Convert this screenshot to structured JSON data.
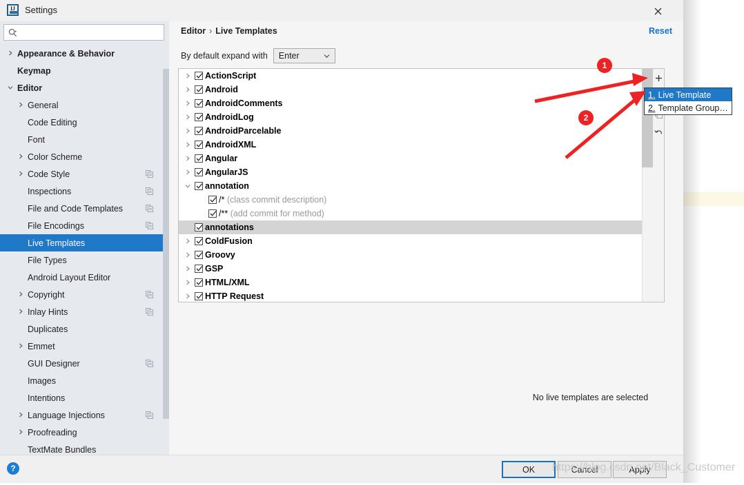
{
  "window": {
    "title": "Settings",
    "app_icon": "intellij-idea-icon",
    "close_icon": "close-icon"
  },
  "search": {
    "placeholder": "",
    "value": "",
    "icon": "search-icon"
  },
  "sidebar": {
    "items": [
      {
        "label": "Appearance & Behavior",
        "level": 0,
        "arrow": "chevron-right-icon",
        "copy": false,
        "selected": false
      },
      {
        "label": "Keymap",
        "level": 0,
        "arrow": "",
        "copy": false,
        "selected": false
      },
      {
        "label": "Editor",
        "level": 0,
        "arrow": "chevron-down-icon",
        "copy": false,
        "selected": false
      },
      {
        "label": "General",
        "level": 1,
        "arrow": "chevron-right-icon",
        "copy": false,
        "selected": false
      },
      {
        "label": "Code Editing",
        "level": 1,
        "arrow": "",
        "copy": false,
        "selected": false
      },
      {
        "label": "Font",
        "level": 1,
        "arrow": "",
        "copy": false,
        "selected": false
      },
      {
        "label": "Color Scheme",
        "level": 1,
        "arrow": "chevron-right-icon",
        "copy": false,
        "selected": false
      },
      {
        "label": "Code Style",
        "level": 1,
        "arrow": "chevron-right-icon",
        "copy": true,
        "selected": false
      },
      {
        "label": "Inspections",
        "level": 1,
        "arrow": "",
        "copy": true,
        "selected": false
      },
      {
        "label": "File and Code Templates",
        "level": 1,
        "arrow": "",
        "copy": true,
        "selected": false
      },
      {
        "label": "File Encodings",
        "level": 1,
        "arrow": "",
        "copy": true,
        "selected": false
      },
      {
        "label": "Live Templates",
        "level": 1,
        "arrow": "",
        "copy": false,
        "selected": true
      },
      {
        "label": "File Types",
        "level": 1,
        "arrow": "",
        "copy": false,
        "selected": false
      },
      {
        "label": "Android Layout Editor",
        "level": 1,
        "arrow": "",
        "copy": false,
        "selected": false
      },
      {
        "label": "Copyright",
        "level": 1,
        "arrow": "chevron-right-icon",
        "copy": true,
        "selected": false
      },
      {
        "label": "Inlay Hints",
        "level": 1,
        "arrow": "chevron-right-icon",
        "copy": true,
        "selected": false
      },
      {
        "label": "Duplicates",
        "level": 1,
        "arrow": "",
        "copy": false,
        "selected": false
      },
      {
        "label": "Emmet",
        "level": 1,
        "arrow": "chevron-right-icon",
        "copy": false,
        "selected": false
      },
      {
        "label": "GUI Designer",
        "level": 1,
        "arrow": "",
        "copy": true,
        "selected": false
      },
      {
        "label": "Images",
        "level": 1,
        "arrow": "",
        "copy": false,
        "selected": false
      },
      {
        "label": "Intentions",
        "level": 1,
        "arrow": "",
        "copy": false,
        "selected": false
      },
      {
        "label": "Language Injections",
        "level": 1,
        "arrow": "chevron-right-icon",
        "copy": true,
        "selected": false
      },
      {
        "label": "Proofreading",
        "level": 1,
        "arrow": "chevron-right-icon",
        "copy": false,
        "selected": false
      },
      {
        "label": "TextMate Bundles",
        "level": 1,
        "arrow": "",
        "copy": false,
        "selected": false
      }
    ]
  },
  "main": {
    "breadcrumb": {
      "parent": "Editor",
      "separator": "›",
      "current": "Live Templates"
    },
    "reset_label": "Reset",
    "expand_label": "By default expand with",
    "expand_value": "Enter",
    "empty_message": "No live templates are selected"
  },
  "templates": {
    "rows": [
      {
        "label": "ActionScript",
        "type": "group",
        "expanded": false,
        "checked": true,
        "selected": false
      },
      {
        "label": "Android",
        "type": "group",
        "expanded": false,
        "checked": true,
        "selected": false
      },
      {
        "label": "AndroidComments",
        "type": "group",
        "expanded": false,
        "checked": true,
        "selected": false
      },
      {
        "label": "AndroidLog",
        "type": "group",
        "expanded": false,
        "checked": true,
        "selected": false
      },
      {
        "label": "AndroidParcelable",
        "type": "group",
        "expanded": false,
        "checked": true,
        "selected": false
      },
      {
        "label": "AndroidXML",
        "type": "group",
        "expanded": false,
        "checked": true,
        "selected": false
      },
      {
        "label": "Angular",
        "type": "group",
        "expanded": false,
        "checked": true,
        "selected": false
      },
      {
        "label": "AngularJS",
        "type": "group",
        "expanded": false,
        "checked": true,
        "selected": false
      },
      {
        "label": "annotation",
        "type": "group",
        "expanded": true,
        "checked": true,
        "selected": false
      },
      {
        "label": "/*",
        "description": "(class commit description)",
        "type": "child",
        "checked": true,
        "selected": false
      },
      {
        "label": "/**",
        "description": "(add commit for method)",
        "type": "child",
        "checked": true,
        "selected": false
      },
      {
        "label": "annotations",
        "type": "group",
        "expanded": false,
        "arrow": false,
        "checked": true,
        "selected": true
      },
      {
        "label": "ColdFusion",
        "type": "group",
        "expanded": false,
        "checked": true,
        "selected": false
      },
      {
        "label": "Groovy",
        "type": "group",
        "expanded": false,
        "checked": true,
        "selected": false
      },
      {
        "label": "GSP",
        "type": "group",
        "expanded": false,
        "checked": true,
        "selected": false
      },
      {
        "label": "HTML/XML",
        "type": "group",
        "expanded": false,
        "checked": true,
        "selected": false
      },
      {
        "label": "HTTP Request",
        "type": "group",
        "expanded": false,
        "checked": true,
        "selected": false
      }
    ],
    "toolbar": [
      {
        "name": "add-button",
        "glyph": "+"
      },
      {
        "name": "copy-button",
        "glyph": "⧉"
      },
      {
        "name": "revert-button",
        "glyph": "↶"
      }
    ]
  },
  "popup": {
    "items": [
      {
        "num": "1.",
        "label": "Live Template",
        "selected": true
      },
      {
        "num": "2.",
        "label": "Template Group…",
        "selected": false
      }
    ]
  },
  "footer": {
    "help_label": "?",
    "ok_label": "OK",
    "cancel_label": "Cancel",
    "apply_label": "Apply"
  },
  "annotations": {
    "badges": [
      {
        "label": "1"
      },
      {
        "label": "2"
      }
    ],
    "arrow_color": "#ee2222"
  },
  "watermark": "https://blog.csdn.net/Black_Customer"
}
